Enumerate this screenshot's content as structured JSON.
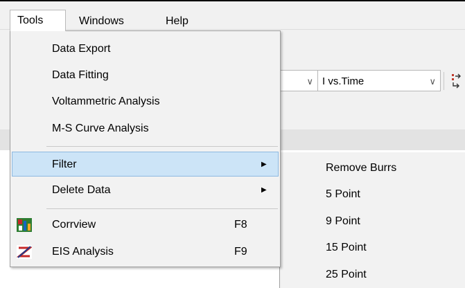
{
  "menubar": {
    "tools": "Tools",
    "windows": "Windows",
    "help": "Help"
  },
  "toolbar": {
    "combo1_value": "",
    "combo2_value": "I vs.Time",
    "arrow_glyph": "∨"
  },
  "tools_menu": {
    "items": [
      {
        "label": "Data Export"
      },
      {
        "label": "Data Fitting"
      },
      {
        "label": "Voltammetric Analysis"
      },
      {
        "label": "M-S Curve Analysis"
      },
      {
        "label": "Filter",
        "submenu": true,
        "highlighted": true
      },
      {
        "label": "Delete Data",
        "submenu": true
      },
      {
        "label": "Corrview",
        "shortcut": "F8",
        "icon": "corrview-icon"
      },
      {
        "label": "EIS Analysis",
        "shortcut": "F9",
        "icon": "eis-analysis-icon"
      }
    ],
    "submenu_arrow": "▶"
  },
  "filter_submenu": {
    "items": [
      {
        "label": "Remove Burrs"
      },
      {
        "label": "5 Point"
      },
      {
        "label": "9 Point"
      },
      {
        "label": "15 Point"
      },
      {
        "label": "25 Point"
      }
    ]
  },
  "colors": {
    "highlight": "#cce4f7",
    "highlight_border": "#8cb8e0",
    "menu_bg": "#f2f2f2"
  }
}
